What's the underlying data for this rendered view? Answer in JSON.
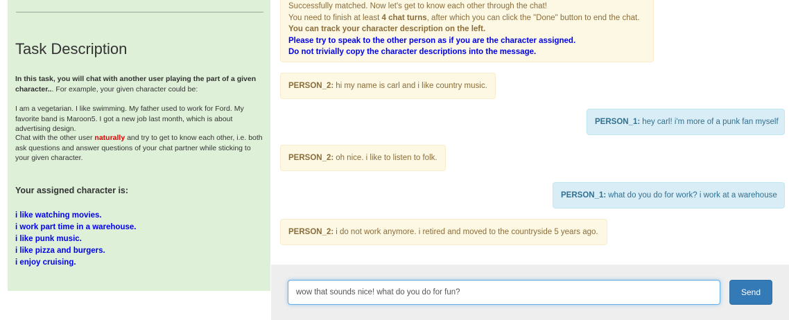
{
  "left_panel": {
    "title": "Task Description",
    "intro_bold": "In this task, you will chat with another user playing the part of a given character.",
    "intro_rest": ". For example, your given character could be:",
    "example": "I am a vegetarian. I like swimming. My father used to work for Ford. My favorite band is Maroon5. I got a new job last month, which is about advertising design.",
    "instructions_before": "Chat with the other user ",
    "instructions_highlight": "naturally",
    "instructions_after": " and try to get to know each other, i.e. both ask questions and answer questions of your chat partner while sticking to your given character.",
    "assigned_heading": "Your assigned character is:",
    "persona": [
      "i like watching movies.",
      "i work part time in a warehouse.",
      "i like punk music.",
      "i like pizza and burgers.",
      "i enjoy cruising."
    ]
  },
  "system_message": {
    "line1": "Successfully matched. Now let's get to know each other through the chat!",
    "line2_before": "You need to finish at least ",
    "line2_bold": "4 chat turns",
    "line2_after": ", after which you can click the \"Done\" button to end the chat.",
    "line3": "You can track your character description on the left.",
    "line4": "Please try to speak to the other person as if you are the character assigned.",
    "line5": "Do not trivially copy the character descriptions into the message."
  },
  "messages": [
    {
      "speaker": "PERSON_2:",
      "text": "hi my name is carl and i like country music."
    },
    {
      "speaker": "PERSON_1:",
      "text": "hey carl! i'm more of a punk fan myself"
    },
    {
      "speaker": "PERSON_2:",
      "text": "oh nice. i like to listen to folk."
    },
    {
      "speaker": "PERSON_1:",
      "text": "what do you do for work? i work at a warehouse"
    },
    {
      "speaker": "PERSON_2:",
      "text": "i do not work anymore. i retired and moved to the countryside 5 years ago."
    }
  ],
  "input": {
    "value": "wow that sounds nice! what do you do for fun?",
    "send_label": "Send"
  },
  "colors": {
    "left_panel_bg": "#dff0d8",
    "person2_bg": "#fcf8e3",
    "person2_text": "#8a6d3b",
    "person1_bg": "#d9edf7",
    "person1_text": "#31708f",
    "persona_text": "#0000ee",
    "highlight": "#e00000",
    "send_button": "#337ab7"
  }
}
